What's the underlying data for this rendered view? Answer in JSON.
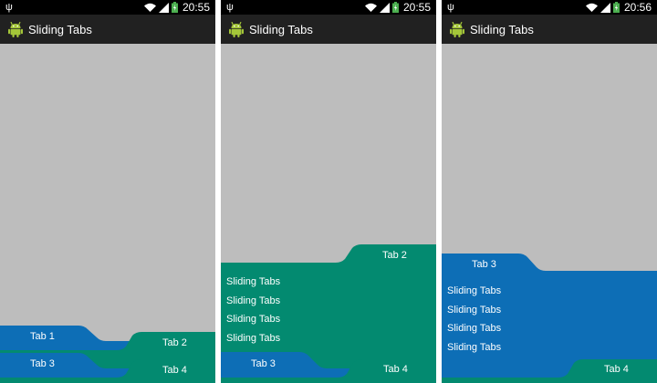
{
  "colors": {
    "content_bg": "#bdbdbd",
    "status_bar": "#000000",
    "action_bar": "#212121",
    "tab_blue": "#0d6eb6",
    "tab_green": "#038a70",
    "text": "#ffffff"
  },
  "screens": [
    {
      "status_time": "20:55",
      "app_title": "Sliding Tabs",
      "tabs": [
        "Tab 1",
        "Tab 2",
        "Tab 3",
        "Tab 4"
      ]
    },
    {
      "status_time": "20:55",
      "app_title": "Sliding Tabs",
      "tabs": [
        "Tab 2",
        "Tab 3",
        "Tab 4"
      ],
      "content_lines": [
        "Sliding Tabs",
        "Sliding Tabs",
        "Sliding Tabs",
        "Sliding Tabs"
      ]
    },
    {
      "status_time": "20:56",
      "app_title": "Sliding Tabs",
      "tabs": [
        "Tab 3",
        "Tab 4"
      ],
      "content_lines": [
        "Sliding Tabs",
        "Sliding Tabs",
        "Sliding Tabs",
        "Sliding Tabs"
      ]
    }
  ]
}
